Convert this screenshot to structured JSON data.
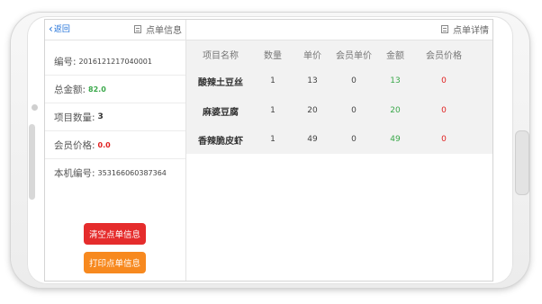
{
  "left_header": {
    "back_label": "返回",
    "title": "点单信息"
  },
  "info": {
    "order_no_label": "编号:",
    "order_no_value": "2016121217040001",
    "total_label": "总金额:",
    "total_value": "82.0",
    "item_count_label": "项目数量:",
    "item_count_value": "3",
    "member_price_label": "会员价格:",
    "member_price_value": "0.0",
    "device_no_label": "本机编号:",
    "device_no_value": "353166060387364"
  },
  "buttons": {
    "clear_label": "清空点单信息",
    "print_label": "打印点单信息"
  },
  "right_header": {
    "title": "点单详情"
  },
  "table": {
    "headers": [
      "项目名称",
      "数量",
      "单价",
      "会员单价",
      "金额",
      "会员价格"
    ],
    "rows": [
      [
        "酸辣土豆丝",
        "1",
        "13",
        "0",
        "13",
        "0"
      ],
      [
        "麻婆豆腐",
        "1",
        "20",
        "0",
        "20",
        "0"
      ],
      [
        "香辣脆皮虾",
        "1",
        "49",
        "0",
        "49",
        "0"
      ]
    ]
  },
  "colors": {
    "accent_link": "#1d6fd8",
    "amount_green": "#3aa84a",
    "member_red": "#e02020",
    "clear_button": "#e52c2c",
    "print_button": "#f7891f"
  },
  "icons": {
    "back": "chevron-left-icon",
    "header": "document-list-icon"
  }
}
